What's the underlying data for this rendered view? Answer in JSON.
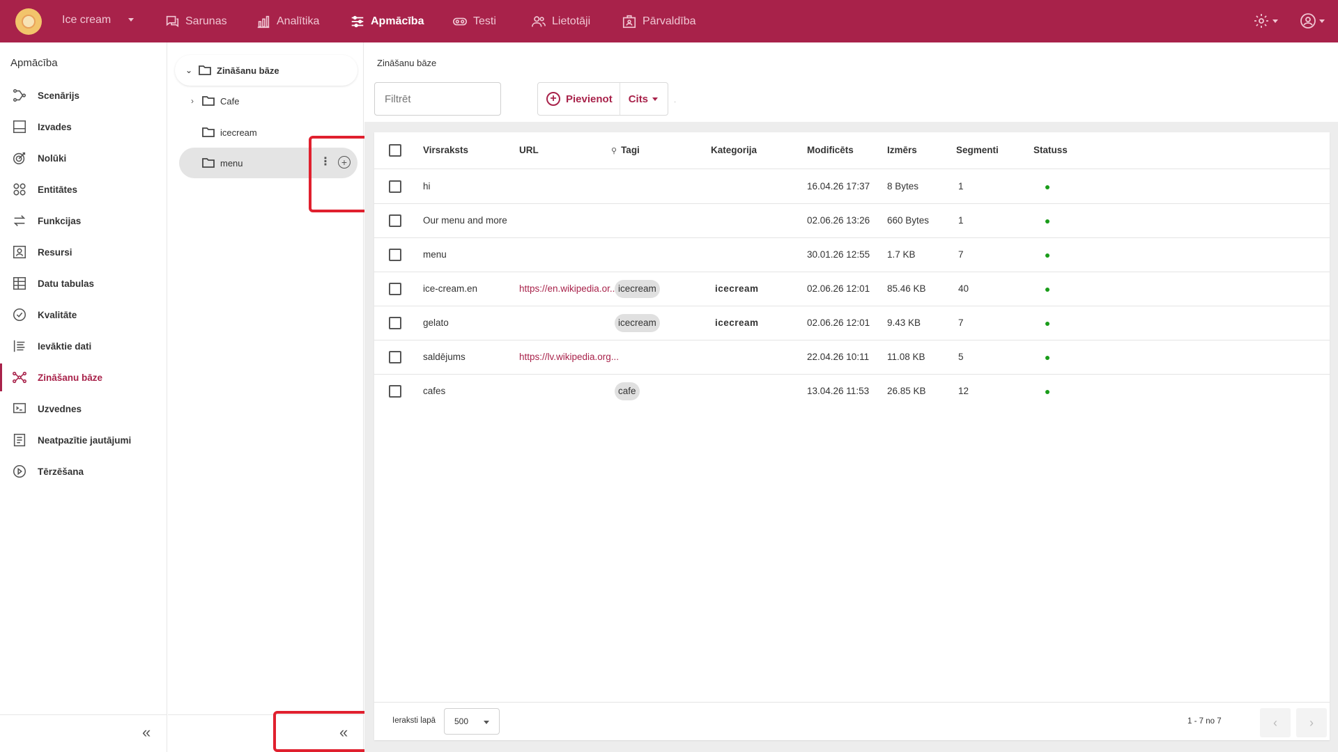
{
  "topbar": {
    "app_name": "Ice cream",
    "nav": [
      {
        "label": "Sarunas",
        "icon": "chat-icon"
      },
      {
        "label": "Analītika",
        "icon": "bar-chart-icon"
      },
      {
        "label": "Apmācība",
        "icon": "sliders-icon",
        "active": true
      },
      {
        "label": "Testi",
        "icon": "test-icon"
      },
      {
        "label": "Lietotāji",
        "icon": "users-icon"
      },
      {
        "label": "Pārvaldība",
        "icon": "admin-icon"
      }
    ],
    "brand_color": "#a8224a"
  },
  "sidebar": {
    "title": "Apmācība",
    "items": [
      {
        "label": "Scenārijs",
        "icon": "flow-icon"
      },
      {
        "label": "Izvades",
        "icon": "output-icon"
      },
      {
        "label": "Nolūki",
        "icon": "target-icon"
      },
      {
        "label": "Entitātes",
        "icon": "entities-icon"
      },
      {
        "label": "Funkcijas",
        "icon": "swap-icon"
      },
      {
        "label": "Resursi",
        "icon": "resource-icon"
      },
      {
        "label": "Datu tabulas",
        "icon": "table-icon"
      },
      {
        "label": "Kvalitāte",
        "icon": "check-circle-icon"
      },
      {
        "label": "Ievāktie dati",
        "icon": "list-icon"
      },
      {
        "label": "Zināšanu bāze",
        "icon": "knowledge-icon",
        "active": true
      },
      {
        "label": "Uzvednes",
        "icon": "prompt-icon"
      },
      {
        "label": "Neatpazītie jautājumi",
        "icon": "unrecognized-icon"
      },
      {
        "label": "Tērzēšana",
        "icon": "play-icon"
      }
    ]
  },
  "tree": {
    "root": "Zināšanu bāze",
    "nodes": [
      {
        "label": "Cafe",
        "expandable": true
      },
      {
        "label": "icecream",
        "expandable": false
      },
      {
        "label": "menu",
        "expandable": false,
        "selected": true
      }
    ]
  },
  "main": {
    "breadcrumb": "Zināšanu bāze",
    "filter_placeholder": "Filtrēt",
    "add_label": "Pievienot",
    "more_label": "Cits",
    "columns": [
      "Virsraksts",
      "URL",
      "Tagi",
      "Kategorija",
      "Modificēts",
      "Izmērs",
      "Segmenti",
      "Statuss"
    ],
    "rows": [
      {
        "title": "hi",
        "url": "",
        "tag": "",
        "category": "",
        "modified": "16.04.26 17:37",
        "size": "8 Bytes",
        "segments": "1",
        "status": "active"
      },
      {
        "title": "Our menu and more",
        "url": "",
        "tag": "",
        "category": "",
        "modified": "02.06.26 13:26",
        "size": "660 Bytes",
        "segments": "1",
        "status": "active"
      },
      {
        "title": "menu",
        "url": "",
        "tag": "",
        "category": "",
        "modified": "30.01.26 12:55",
        "size": "1.7 KB",
        "segments": "7",
        "status": "active"
      },
      {
        "title": "ice-cream.en",
        "url": "https://en.wikipedia.or...",
        "tag": "icecream",
        "category": "icecream",
        "modified": "02.06.26 12:01",
        "size": "85.46 KB",
        "segments": "40",
        "status": "active"
      },
      {
        "title": "gelato",
        "url": "",
        "tag": "icecream",
        "category": "icecream",
        "modified": "02.06.26 12:01",
        "size": "9.43 KB",
        "segments": "7",
        "status": "active"
      },
      {
        "title": "saldējums",
        "url": "https://lv.wikipedia.org...",
        "tag": "",
        "category": "",
        "modified": "22.04.26 10:11",
        "size": "11.08 KB",
        "segments": "5",
        "status": "active"
      },
      {
        "title": "cafes",
        "url": "",
        "tag": "cafe",
        "category": "",
        "modified": "13.04.26 11:53",
        "size": "26.85 KB",
        "segments": "12",
        "status": "active"
      }
    ],
    "per_page_label": "Ieraksti lapā",
    "per_page_value": "500",
    "range": "1 - 7 no 7",
    "status_color": "#1a9c1a"
  }
}
